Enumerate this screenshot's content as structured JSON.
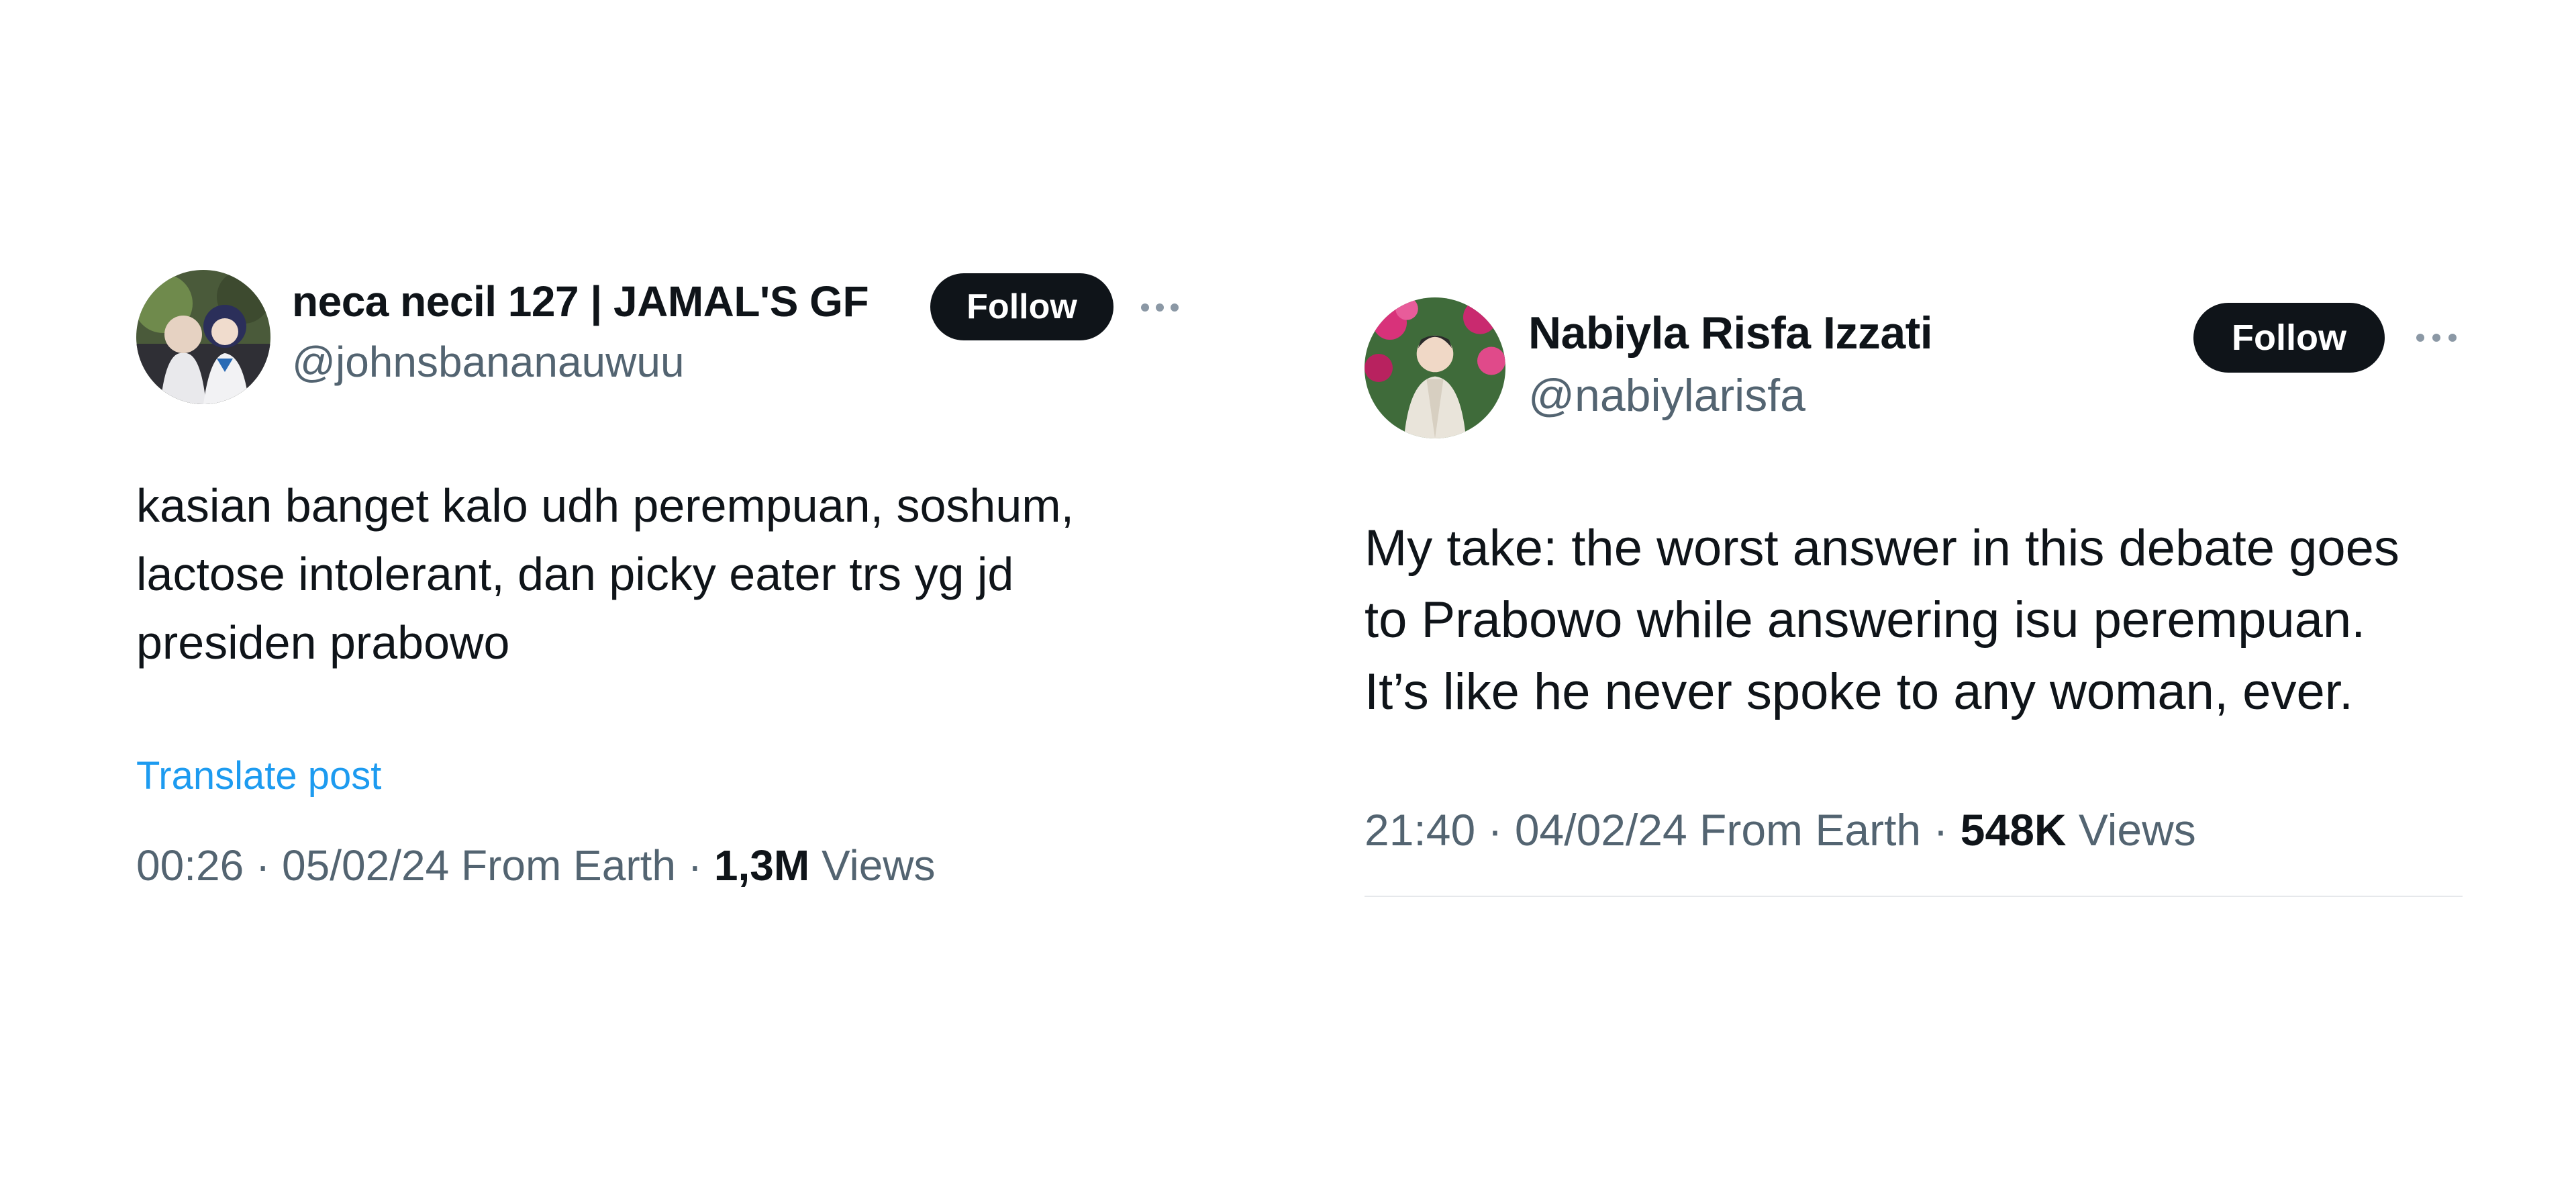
{
  "tweets": [
    {
      "display_name": "neca necil 127 | JAMAL'S GF",
      "handle": "@johnsbananauwuu",
      "follow_label": "Follow",
      "text": "kasian banget kalo udh perempuan, soshum,\nlactose intolerant, dan picky eater trs yg jd\npresiden prabowo",
      "translate_label": "Translate post",
      "timestamp": "00:26 · 05/02/24 From Earth · ",
      "views_count": "1,3M",
      "views_label": " Views",
      "avatar_icon": "avatar-photo-icon"
    },
    {
      "display_name": "Nabiyla Risfa Izzati",
      "handle": "@nabiylarisfa",
      "follow_label": "Follow",
      "text": "My take: the worst answer in this debate goes\nto Prabowo while answering isu perempuan.\nIt’s like he never spoke to any woman, ever.",
      "timestamp": "21:40 · 04/02/24 From Earth · ",
      "views_count": "548K",
      "views_label": " Views",
      "avatar_icon": "avatar-photo-icon"
    }
  ],
  "colors": {
    "text_primary": "#0f1419",
    "text_secondary": "#536471",
    "link": "#1d9bf0",
    "button_bg": "#0f1419",
    "button_text": "#ffffff"
  }
}
